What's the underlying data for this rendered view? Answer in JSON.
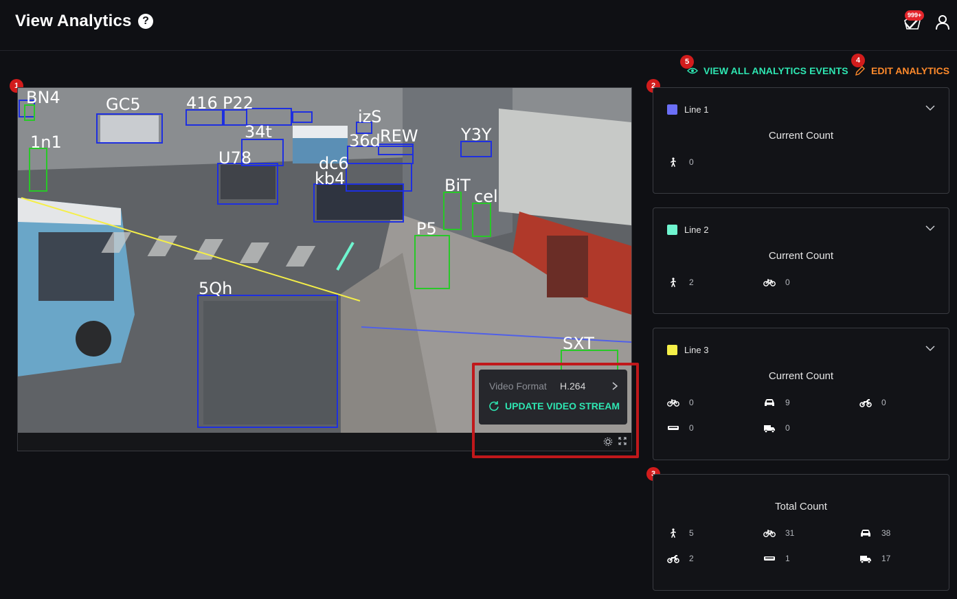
{
  "header": {
    "title": "View Analytics",
    "notification_count": "999+"
  },
  "actions": {
    "view_all_events": "VIEW ALL ANALYTICS EVENTS",
    "edit_analytics": "EDIT ANALYTICS"
  },
  "steps": [
    "1",
    "2",
    "3",
    "4",
    "5"
  ],
  "video": {
    "format_label": "Video Format",
    "format_value": "H.264",
    "update_label": "UPDATE VIDEO STREAM",
    "detections": [
      {
        "label": "BN4",
        "color": "blue"
      },
      {
        "label": "GC5",
        "color": "blue"
      },
      {
        "label": "1n1",
        "color": "green"
      },
      {
        "label": "416",
        "color": "blue"
      },
      {
        "label": "P22",
        "color": "blue"
      },
      {
        "label": "34t",
        "color": "blue"
      },
      {
        "label": "U78",
        "color": "blue"
      },
      {
        "label": "izS",
        "color": "blue"
      },
      {
        "label": "36d",
        "color": "blue"
      },
      {
        "label": "REW",
        "color": "blue"
      },
      {
        "label": "dc6",
        "color": "blue"
      },
      {
        "label": "kb4",
        "color": "blue"
      },
      {
        "label": "Y3Y",
        "color": "blue"
      },
      {
        "label": "BiT",
        "color": "green"
      },
      {
        "label": "cel",
        "color": "green"
      },
      {
        "label": "P5",
        "color": "green"
      },
      {
        "label": "5Qh",
        "color": "blue"
      },
      {
        "label": "SXT",
        "color": "green"
      }
    ]
  },
  "lines": [
    {
      "name": "Line 1",
      "color": "#6b6ff7",
      "subtitle": "Current Count",
      "counts": [
        {
          "icon": "person-icon",
          "value": "0"
        }
      ]
    },
    {
      "name": "Line 2",
      "color": "#6ff5cf",
      "subtitle": "Current Count",
      "counts": [
        {
          "icon": "person-icon",
          "value": "2"
        },
        {
          "icon": "bicycle-icon",
          "value": "0"
        }
      ]
    },
    {
      "name": "Line 3",
      "color": "#f5ef48",
      "subtitle": "Current Count",
      "counts": [
        {
          "icon": "bicycle-icon",
          "value": "0"
        },
        {
          "icon": "car-icon",
          "value": "9"
        },
        {
          "icon": "motorcycle-icon",
          "value": "0"
        },
        {
          "icon": "bus-icon",
          "value": "0"
        },
        {
          "icon": "truck-icon",
          "value": "0"
        }
      ]
    }
  ],
  "total": {
    "subtitle": "Total Count",
    "counts": [
      {
        "icon": "person-icon",
        "value": "5"
      },
      {
        "icon": "bicycle-icon",
        "value": "31"
      },
      {
        "icon": "car-icon",
        "value": "38"
      },
      {
        "icon": "motorcycle-icon",
        "value": "2"
      },
      {
        "icon": "bus-icon",
        "value": "1"
      },
      {
        "icon": "truck-icon",
        "value": "17"
      }
    ]
  }
}
